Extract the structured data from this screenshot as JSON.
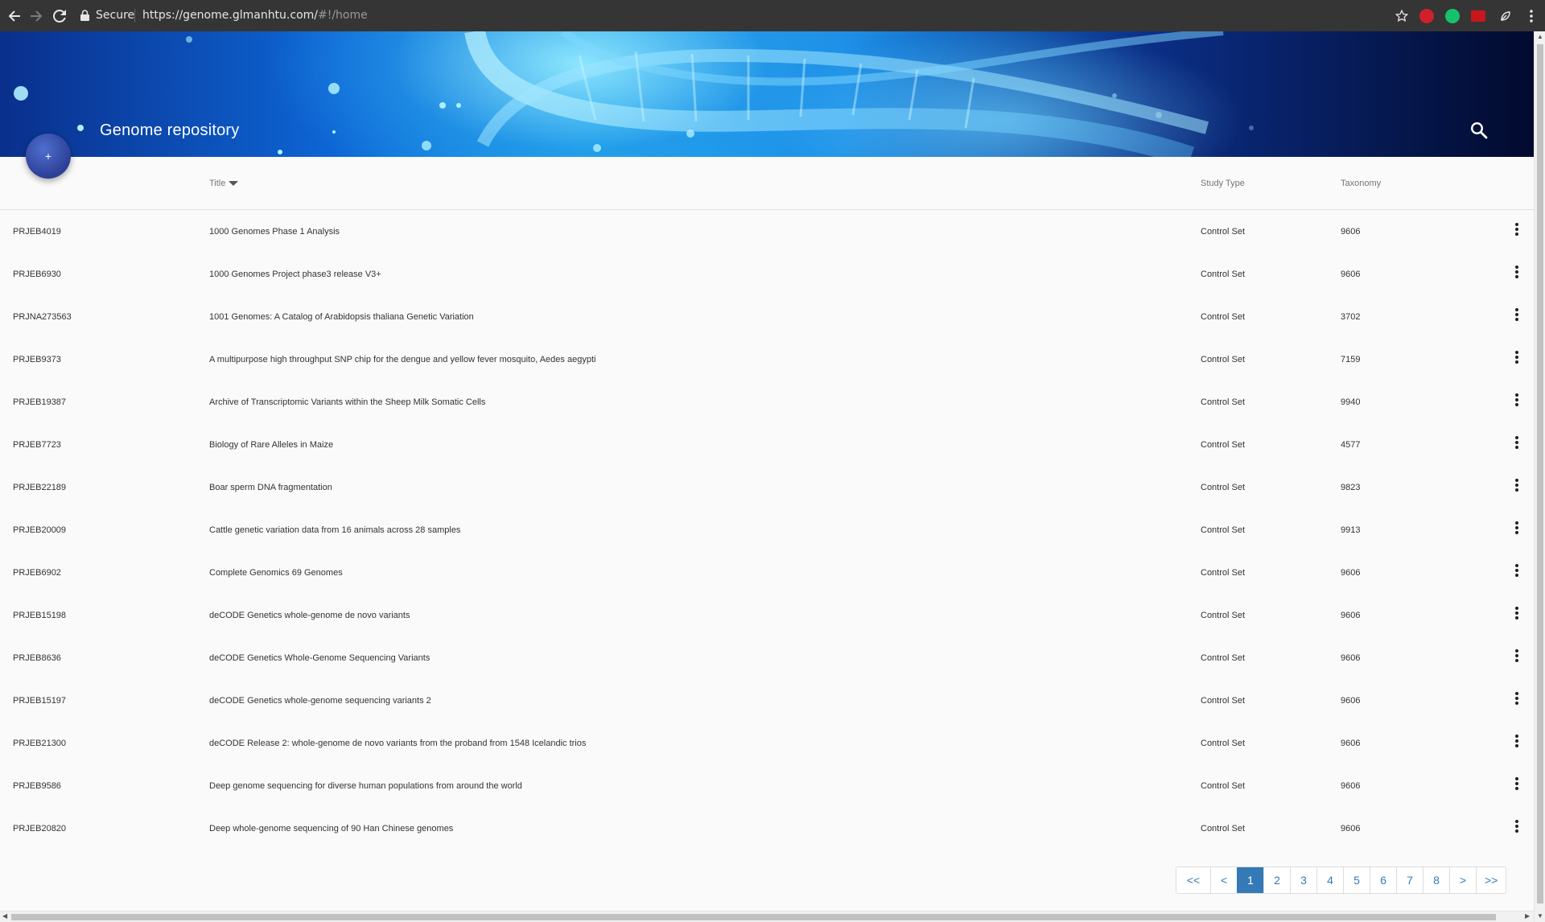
{
  "browser": {
    "secure_label": "Secure",
    "url_host": "https://genome.glmanhtu.com/",
    "url_rest": "#!/home"
  },
  "header": {
    "title": "Genome repository",
    "add_label": "+"
  },
  "table": {
    "columns": {
      "title": "Title",
      "study_type": "Study Type",
      "taxonomy": "Taxonomy"
    },
    "rows": [
      {
        "id": "PRJEB4019",
        "title": "1000 Genomes Phase 1 Analysis",
        "study_type": "Control Set",
        "taxonomy": "9606"
      },
      {
        "id": "PRJEB6930",
        "title": "1000 Genomes Project phase3 release V3+",
        "study_type": "Control Set",
        "taxonomy": "9606"
      },
      {
        "id": "PRJNA273563",
        "title": "1001 Genomes: A Catalog of Arabidopsis thaliana Genetic Variation",
        "study_type": "Control Set",
        "taxonomy": "3702"
      },
      {
        "id": "PRJEB9373",
        "title": "A multipurpose high throughput SNP chip for the dengue and yellow fever mosquito, Aedes aegypti",
        "study_type": "Control Set",
        "taxonomy": "7159"
      },
      {
        "id": "PRJEB19387",
        "title": "Archive of Transcriptomic Variants within the Sheep Milk Somatic Cells",
        "study_type": "Control Set",
        "taxonomy": "9940"
      },
      {
        "id": "PRJEB7723",
        "title": "Biology of Rare Alleles in Maize",
        "study_type": "Control Set",
        "taxonomy": "4577"
      },
      {
        "id": "PRJEB22189",
        "title": "Boar sperm DNA fragmentation",
        "study_type": "Control Set",
        "taxonomy": "9823"
      },
      {
        "id": "PRJEB20009",
        "title": "Cattle genetic variation data from 16 animals across 28 samples",
        "study_type": "Control Set",
        "taxonomy": "9913"
      },
      {
        "id": "PRJEB6902",
        "title": "Complete Genomics 69 Genomes",
        "study_type": "Control Set",
        "taxonomy": "9606"
      },
      {
        "id": "PRJEB15198",
        "title": "deCODE Genetics whole-genome de novo variants",
        "study_type": "Control Set",
        "taxonomy": "9606"
      },
      {
        "id": "PRJEB8636",
        "title": "deCODE Genetics Whole-Genome Sequencing Variants",
        "study_type": "Control Set",
        "taxonomy": "9606"
      },
      {
        "id": "PRJEB15197",
        "title": "deCODE Genetics whole-genome sequencing variants 2",
        "study_type": "Control Set",
        "taxonomy": "9606"
      },
      {
        "id": "PRJEB21300",
        "title": "deCODE Release 2: whole-genome de novo variants from the proband from 1548 Icelandic trios",
        "study_type": "Control Set",
        "taxonomy": "9606"
      },
      {
        "id": "PRJEB9586",
        "title": "Deep genome sequencing for diverse human populations from around the world",
        "study_type": "Control Set",
        "taxonomy": "9606"
      },
      {
        "id": "PRJEB20820",
        "title": "Deep whole-genome sequencing of 90 Han Chinese genomes",
        "study_type": "Control Set",
        "taxonomy": "9606"
      }
    ]
  },
  "pagination": {
    "pages": [
      "<<",
      "<",
      "1",
      "2",
      "3",
      "4",
      "5",
      "6",
      "7",
      "8",
      ">",
      ">>"
    ],
    "current": "1"
  },
  "colors": {
    "accent": "#337ab7",
    "fab": "#2c3f96"
  }
}
